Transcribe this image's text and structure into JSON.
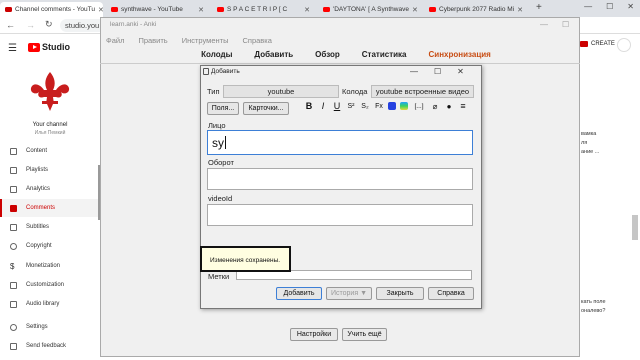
{
  "browser": {
    "tabs": [
      {
        "title": "Channel comments - YouTu"
      },
      {
        "title": "synthwave - YouTube"
      },
      {
        "title": "S P A C E   T R I P [ C"
      },
      {
        "title": "'DAYTONA' [ A Synthwave"
      },
      {
        "title": "Cyberpunk 2077 Radio Mi"
      }
    ],
    "new_tab": "+",
    "url": "studio.you"
  },
  "studio": {
    "brand": "Studio",
    "your_channel": "Your channel",
    "channel_name": "Илья Пемкий",
    "nav": [
      {
        "label": "Content"
      },
      {
        "label": "Playlists"
      },
      {
        "label": "Analytics"
      },
      {
        "label": "Comments"
      },
      {
        "label": "Subtitles"
      },
      {
        "label": "Copyright"
      },
      {
        "label": "Monetization"
      },
      {
        "label": "Customization"
      },
      {
        "label": "Audio library"
      },
      {
        "label": "Settings"
      },
      {
        "label": "Send feedback"
      }
    ],
    "create": "CREATE",
    "side_texts": [
      "вамка",
      "ля",
      "ание ...",
      "кать поле",
      "оналево?"
    ]
  },
  "anki": {
    "window_title": "learn.anki - Anki",
    "menu": [
      "Файл",
      "Править",
      "Инструменты",
      "Справка"
    ],
    "toolbar": [
      "Колоды",
      "Добавить",
      "Обзор",
      "Статистика",
      "Синхронизация"
    ],
    "bottom_buttons": [
      "Настройки",
      "Учить ещё"
    ]
  },
  "add_dialog": {
    "title": "Добавить",
    "type_label": "Тип",
    "type_value": "youtube",
    "deck_label": "Колода",
    "deck_value": "youtube встроенные видео",
    "fields_button": "Поля...",
    "cards_button": "Карточки...",
    "format_buttons": [
      "B",
      "I",
      "U",
      "S²",
      "S₂",
      "Fx",
      "[...]",
      "≡"
    ],
    "fields": [
      {
        "label": "Лицо",
        "value": "sy"
      },
      {
        "label": "Оборот",
        "value": ""
      },
      {
        "label": "videoId",
        "value": ""
      }
    ],
    "tooltip": "Изменения сохранены.",
    "tags_label": "Метки",
    "buttons": {
      "add": "Добавить",
      "history": "История ▼",
      "close": "Закрыть",
      "help": "Справка"
    }
  }
}
